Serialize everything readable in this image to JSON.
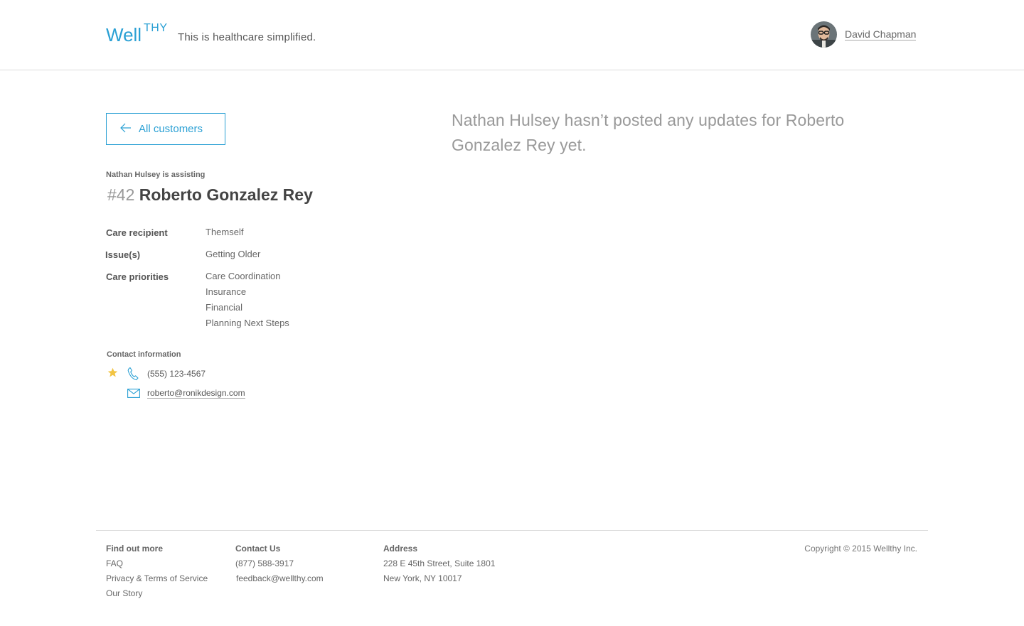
{
  "header": {
    "logo_main": "Well",
    "logo_super": "THY",
    "tagline": "This is healthcare simplified.",
    "user_name": "David Chapman"
  },
  "back_button": {
    "label": "All customers"
  },
  "customer": {
    "assisting": "Nathan Hulsey is assisting",
    "number": "#42",
    "name": "Roberto Gonzalez Rey"
  },
  "details": {
    "care_recipient_label": "Care recipient",
    "care_recipient_value": "Themself",
    "issues_label": "Issue(s)",
    "issues_value": "Getting Older",
    "priorities_label": "Care priorities",
    "priorities": [
      "Care Coordination",
      "Insurance",
      "Financial",
      "Planning Next Steps"
    ]
  },
  "contact": {
    "title": "Contact information",
    "phone": "(555) 123-4567",
    "email": "roberto@ronikdesign.com"
  },
  "updates": {
    "message": "Nathan Hulsey hasn’t posted any updates for Roberto Gonzalez Rey yet."
  },
  "footer": {
    "find_title": "Find out more",
    "find_links": [
      "FAQ",
      "Privacy & Terms of Service",
      "Our Story"
    ],
    "contact_title": "Contact Us",
    "contact_phone": "(877) 588-3917",
    "contact_email": "feedback@wellthy.com",
    "address_title": "Address",
    "address_line1": "228 E 45th Street, Suite 1801",
    "address_line2": "New York, NY 10017",
    "copyright": "Copyright © 2015 Wellthy  Inc."
  },
  "colors": {
    "accent": "#2aa0d4",
    "star": "#f2c443"
  },
  "icons": [
    "arrow-left-icon",
    "star-icon",
    "phone-icon",
    "mail-icon"
  ]
}
